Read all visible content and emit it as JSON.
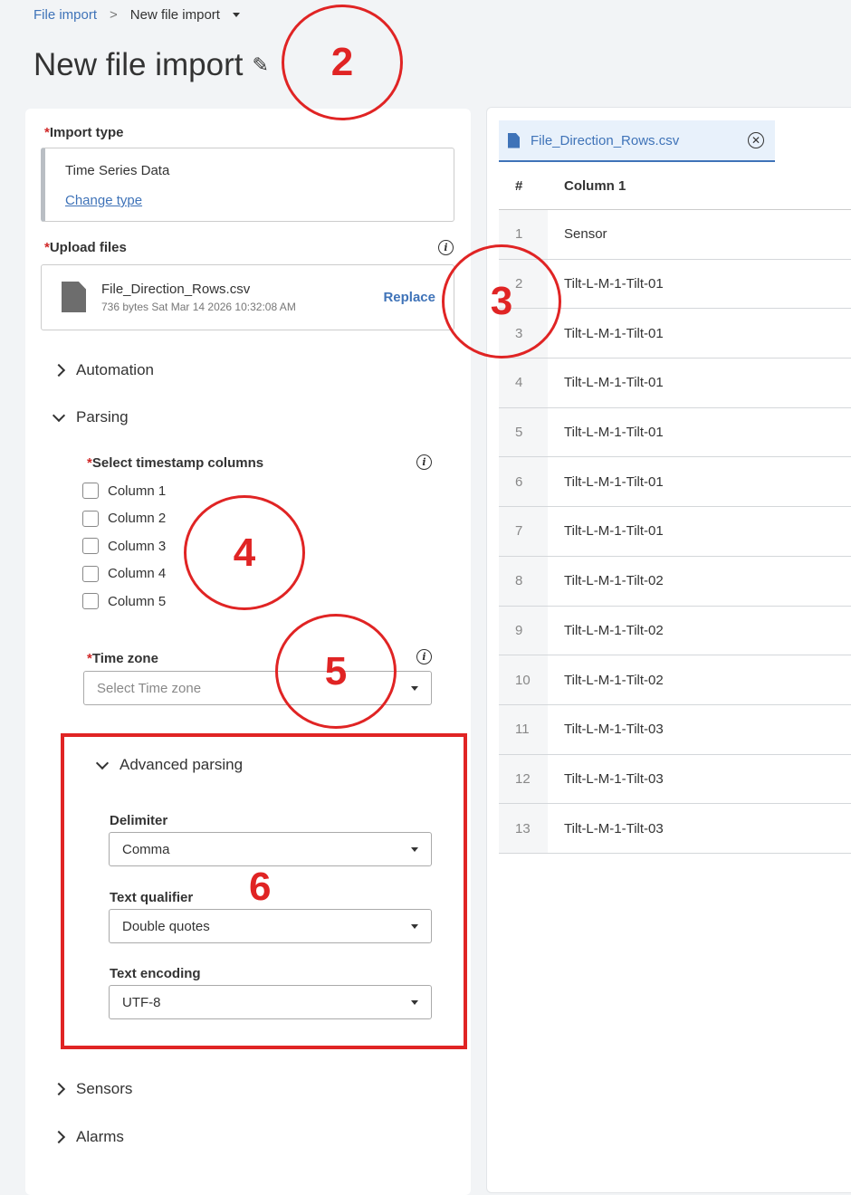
{
  "breadcrumb": {
    "parent": "File import",
    "separator": ">",
    "current": "New file import"
  },
  "page_title": "New file import",
  "form": {
    "import_type": {
      "label": "Import type",
      "required_mark": "*",
      "value": "Time Series Data",
      "change_link": "Change type"
    },
    "upload": {
      "label": "Upload files",
      "required_mark": "*",
      "file_name": "File_Direction_Rows.csv",
      "file_meta": "736 bytes Sat Mar 14 2026 10:32:08 AM",
      "replace": "Replace"
    },
    "sections": {
      "automation": "Automation",
      "parsing": "Parsing",
      "advanced": "Advanced parsing",
      "sensors": "Sensors",
      "alarms": "Alarms"
    },
    "timestamp": {
      "label": "Select timestamp columns",
      "required_mark": "*",
      "columns": [
        "Column 1",
        "Column 2",
        "Column 3",
        "Column 4",
        "Column 5"
      ]
    },
    "timezone": {
      "label": "Time zone",
      "required_mark": "*",
      "placeholder": "Select Time zone"
    },
    "delimiter": {
      "label": "Delimiter",
      "value": "Comma"
    },
    "qualifier": {
      "label": "Text qualifier",
      "value": "Double quotes"
    },
    "encoding": {
      "label": "Text encoding",
      "value": "UTF-8"
    }
  },
  "preview": {
    "tab": "File_Direction_Rows.csv",
    "headers": [
      "#",
      "Column 1"
    ],
    "rows": [
      [
        "1",
        "Sensor"
      ],
      [
        "2",
        "Tilt-L-M-1-Tilt-01"
      ],
      [
        "3",
        "Tilt-L-M-1-Tilt-01"
      ],
      [
        "4",
        "Tilt-L-M-1-Tilt-01"
      ],
      [
        "5",
        "Tilt-L-M-1-Tilt-01"
      ],
      [
        "6",
        "Tilt-L-M-1-Tilt-01"
      ],
      [
        "7",
        "Tilt-L-M-1-Tilt-01"
      ],
      [
        "8",
        "Tilt-L-M-1-Tilt-02"
      ],
      [
        "9",
        "Tilt-L-M-1-Tilt-02"
      ],
      [
        "10",
        "Tilt-L-M-1-Tilt-02"
      ],
      [
        "11",
        "Tilt-L-M-1-Tilt-03"
      ],
      [
        "12",
        "Tilt-L-M-1-Tilt-03"
      ],
      [
        "13",
        "Tilt-L-M-1-Tilt-03"
      ]
    ]
  },
  "annotations": [
    "2",
    "3",
    "4",
    "5",
    "6"
  ],
  "colors": {
    "accent": "#3f73b8",
    "annotation": "#e02424"
  }
}
